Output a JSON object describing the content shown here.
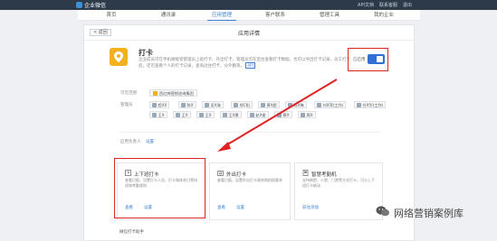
{
  "topbar": {
    "logo_text": "企业微信",
    "links": [
      "API文档",
      "联系客服",
      "退出"
    ]
  },
  "nav": {
    "items": [
      "首页",
      "通讯录",
      "应用管理",
      "客户联系",
      "管理工具",
      "我的企业"
    ],
    "active_index": 2
  },
  "panel": {
    "back_label": "< 返回",
    "title": "应用详情"
  },
  "app": {
    "name": "打卡",
    "desc": "企业成员可在手机端接受管理员上班打卡、外出打卡，管理员可在后台查看打卡数据，也可以导出打卡记录，员工打卡后，还可查看个人的打卡记录，查询过往打卡，分外勤等。",
    "desc_tag": "API"
  },
  "enable": {
    "label": "已启用",
    "on": true
  },
  "scope": {
    "label": "可见范围",
    "dept": "西红柿营销咨询集团"
  },
  "managers": {
    "label": "管理员",
    "people": [
      "程XX",
      "陈X",
      "吴X海",
      "邬C阳",
      "黄X超",
      "陈X锋",
      "刘X萍(工作)",
      "任X华(工作)",
      "王X",
      "王X",
      "王X",
      "王X景",
      "赵X俊",
      "黄X",
      "周X"
    ]
  },
  "manager_row": {
    "label": "应用负责人",
    "set_label": "设置"
  },
  "cards": [
    {
      "title": "上下班打卡",
      "desc": "查看日报、设置打卡人员、打卡和休息日等排班和考勤规则",
      "link_view": "查看",
      "link_set": "设置"
    },
    {
      "title": "外出打卡",
      "desc": "查看日报，设置外出打卡规则和拍照要求",
      "link_view": "查看",
      "link_set": "设置"
    },
    {
      "title": "智慧考勤机",
      "desc": "支持刷脸、人脸、门禁等方式打卡，可与上下班打卡联动",
      "link_view": "前往添加",
      "link_set": ""
    }
  ],
  "footer": "微信打卡助手",
  "watermark": "网络营销案例库",
  "colors": {
    "accent": "#3b7fd0",
    "highlight": "#e02424",
    "app_icon": "#f3b021",
    "topbar": "#2c3a4a"
  },
  "icons": [
    "location-pin-icon",
    "clock-icon",
    "camera-icon",
    "device-icon",
    "wechat-icon"
  ]
}
